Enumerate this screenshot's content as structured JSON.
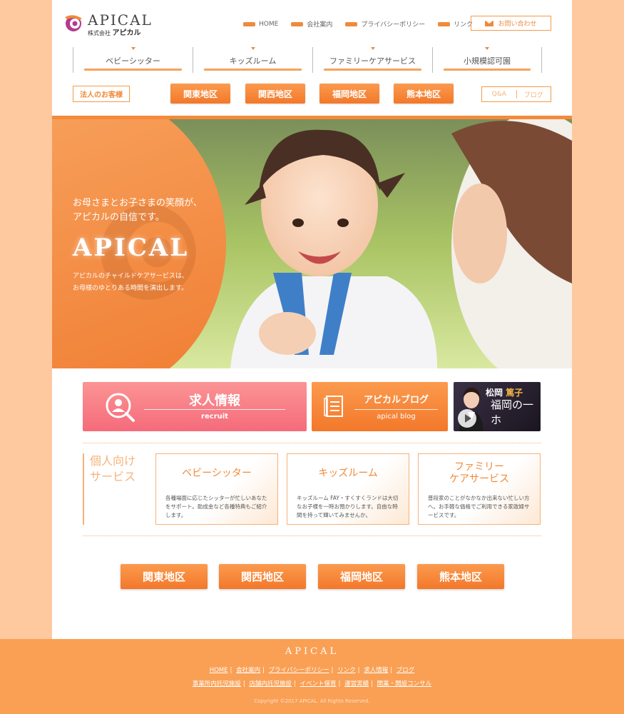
{
  "header": {
    "logo_text": "APICAL",
    "logo_sub_prefix": "株式会社",
    "logo_sub_name": "アピカル",
    "top_links": [
      "HOME",
      "会社案内",
      "プライバシーポリシー",
      "リンク"
    ],
    "contact_label": "お問い合わせ"
  },
  "services_nav": [
    "ベビーシッター",
    "キッズルーム",
    "ファミリーケアサービス",
    "小規模認可園"
  ],
  "corporate_button": "法人のお客様",
  "areas": [
    "関東地区",
    "関西地区",
    "福岡地区",
    "熊本地区"
  ],
  "qa_links": [
    "Q&A",
    "ブログ"
  ],
  "hero": {
    "line1": "お母さまとお子さまの笑顔が、",
    "line2": "アピカルの自信です。",
    "brand": "APICAL",
    "sub1": "アピカルのチャイルドケアサービスは、",
    "sub2": "お母様のゆとりある時間を演出します。"
  },
  "banners": {
    "recruit_title": "求人情報",
    "recruit_sub": "recruit",
    "blog_title": "アピカルブログ",
    "blog_sub": "apical blog",
    "video_name_a": "松岡",
    "video_name_b": "篤子",
    "video_show": "福岡の一ホ"
  },
  "personal_services": {
    "heading_line1": "個人向け",
    "heading_line2": "サービス",
    "cards": [
      {
        "title_line1": "ベビーシッター",
        "title_line2": "",
        "desc": "各種場面に応じたシッターが忙しいあなたをサポート。助成金など各種特典もご紹介します。"
      },
      {
        "title_line1": "キッズルーム",
        "title_line2": "",
        "desc": "キッズルーム FAY・すくすくランドは大切なお子様を一時お預かりします。自由な時間を持って輝いてみませんか。"
      },
      {
        "title_line1": "ファミリー",
        "title_line2": "ケアサービス",
        "desc": "普段家のことがなかなか出来ない忙しい方へ。お手軽な価格でご利用できる家政婦サービスです。"
      }
    ]
  },
  "footer": {
    "brand": "APICAL",
    "links_row1": [
      "HOME",
      "会社案内",
      "プライバシーポリシー",
      "リンク",
      "求人情報",
      "ブログ"
    ],
    "links_row2": [
      "事業所内託児施設",
      "店舗内託児施設",
      "イベント保育",
      "運営実績",
      "開業・開設コンサル"
    ],
    "copyright": "Copyright ©2017 APICAL. All Rights Reserved."
  },
  "colors": {
    "accent": "#f3782a",
    "accent_light": "#f7b27a",
    "pink": "#f56b7b",
    "background": "#ffc9a0"
  }
}
